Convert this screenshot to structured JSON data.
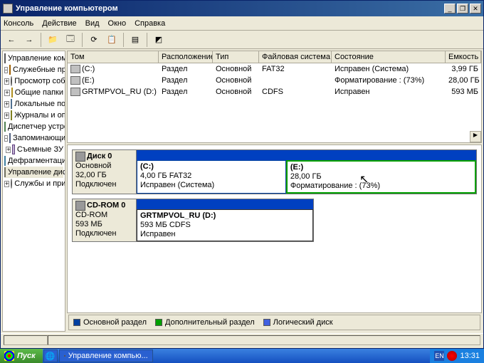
{
  "window": {
    "title": "Управление компьютером"
  },
  "menu": {
    "console": "Консоль",
    "action": "Действие",
    "view": "Вид",
    "window": "Окно",
    "help": "Справка"
  },
  "tree": {
    "root": "Управление компьютером (локал",
    "tools": "Служебные программы",
    "events": "Просмотр событий",
    "shared": "Общие папки",
    "users": "Локальные пользователи",
    "logs": "Журналы и оповещения",
    "devmgr": "Диспетчер устройств",
    "storage": "Запоминающие устройства",
    "removable": "Съемные ЗУ",
    "defrag": "Дефрагментация диска",
    "diskmgmt": "Управление дисками",
    "services": "Службы и приложения"
  },
  "list": {
    "hdr": {
      "vol": "Том",
      "layout": "Расположение",
      "type": "Тип",
      "fs": "Файловая система",
      "status": "Состояние",
      "capacity": "Емкость"
    },
    "rows": [
      {
        "vol": "(C:)",
        "layout": "Раздел",
        "type": "Основной",
        "fs": "FAT32",
        "status": "Исправен (Система)",
        "capacity": "3,99 ГБ"
      },
      {
        "vol": "(E:)",
        "layout": "Раздел",
        "type": "Основной",
        "fs": "",
        "status": "Форматирование : (73%)",
        "capacity": "28,00 ГБ"
      },
      {
        "vol": "GRTMPVOL_RU (D:)",
        "layout": "Раздел",
        "type": "Основной",
        "fs": "CDFS",
        "status": "Исправен",
        "capacity": "593 МБ"
      }
    ]
  },
  "disks": {
    "d0": {
      "name": "Диск 0",
      "type": "Основной",
      "size": "32,00 ГБ",
      "state": "Подключен",
      "p1": {
        "name": "(C:)",
        "l2": "4,00 ГБ FAT32",
        "l3": "Исправен (Система)"
      },
      "p2": {
        "name": "(E:)",
        "l2": "28,00 ГБ",
        "l3": "Форматирование : (73%)"
      }
    },
    "cd": {
      "name": "CD-ROM 0",
      "type": "CD-ROM",
      "size": "593 МБ",
      "state": "Подключен",
      "p1": {
        "name": "GRTMPVOL_RU (D:)",
        "l2": "593 МБ CDFS",
        "l3": "Исправен"
      }
    }
  },
  "legend": {
    "primary": "Основной раздел",
    "extended": "Дополнительный раздел",
    "logical": "Логический диск"
  },
  "taskbar": {
    "start": "Пуск",
    "app": "Управление компью...",
    "lang": "EN",
    "time": "13:31"
  }
}
